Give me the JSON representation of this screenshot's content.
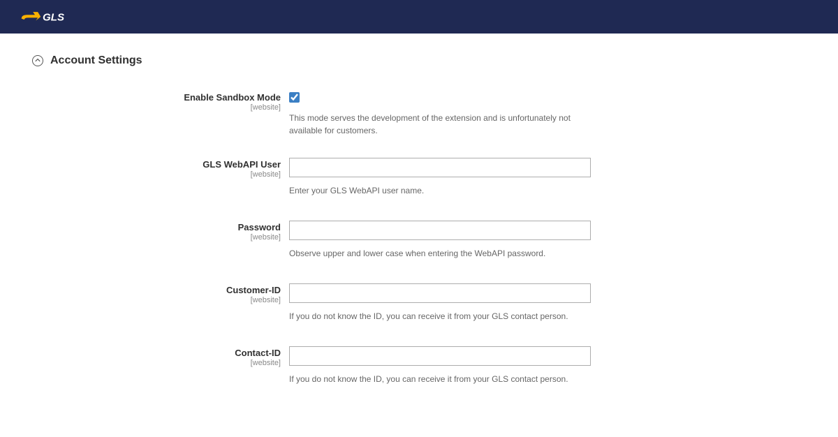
{
  "brand": {
    "name": "GLS"
  },
  "section": {
    "title": "Account Settings"
  },
  "fields": {
    "sandbox": {
      "label": "Enable Sandbox Mode",
      "scope": "[website]",
      "checked": true,
      "help": "This mode serves the development of the extension and is unfortunately not available for customers."
    },
    "webapi_user": {
      "label": "GLS WebAPI User",
      "scope": "[website]",
      "value": "",
      "help": "Enter your GLS WebAPI user name."
    },
    "password": {
      "label": "Password",
      "scope": "[website]",
      "value": "",
      "help": "Observe upper and lower case when entering the WebAPI password."
    },
    "customer_id": {
      "label": "Customer-ID",
      "scope": "[website]",
      "value": "",
      "help": "If you do not know the ID, you can receive it from your GLS contact person."
    },
    "contact_id": {
      "label": "Contact-ID",
      "scope": "[website]",
      "value": "",
      "help": "If you do not know the ID, you can receive it from your GLS contact person."
    }
  }
}
